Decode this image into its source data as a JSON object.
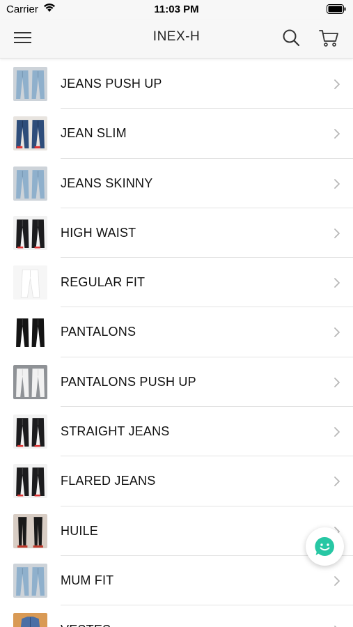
{
  "status_bar": {
    "carrier": "Carrier",
    "time": "11:03 PM"
  },
  "nav": {
    "title": "INEX-H"
  },
  "colors": {
    "chat_accent": "#27c7a4",
    "separator": "#e3e3e3",
    "chevron": "#b8b8b8"
  },
  "categories": [
    {
      "label": "JEANS PUSH UP",
      "thumb": "light-blue-jeans"
    },
    {
      "label": "JEAN SLIM",
      "thumb": "dark-blue-jeans"
    },
    {
      "label": "JEANS SKINNY",
      "thumb": "light-blue-jeans"
    },
    {
      "label": "HIGH WAIST",
      "thumb": "black-jeans"
    },
    {
      "label": "REGULAR FIT",
      "thumb": "white-jeans"
    },
    {
      "label": "PANTALONS",
      "thumb": "black-pants"
    },
    {
      "label": "PANTALONS PUSH UP",
      "thumb": "white-pants"
    },
    {
      "label": "STRAIGHT JEANS",
      "thumb": "black-jeans"
    },
    {
      "label": "FLARED JEANS",
      "thumb": "black-jeans"
    },
    {
      "label": "HUILE",
      "thumb": "black-leggings"
    },
    {
      "label": "MUM FIT",
      "thumb": "light-blue-jeans"
    },
    {
      "label": "VESTES",
      "thumb": "jacket"
    }
  ]
}
